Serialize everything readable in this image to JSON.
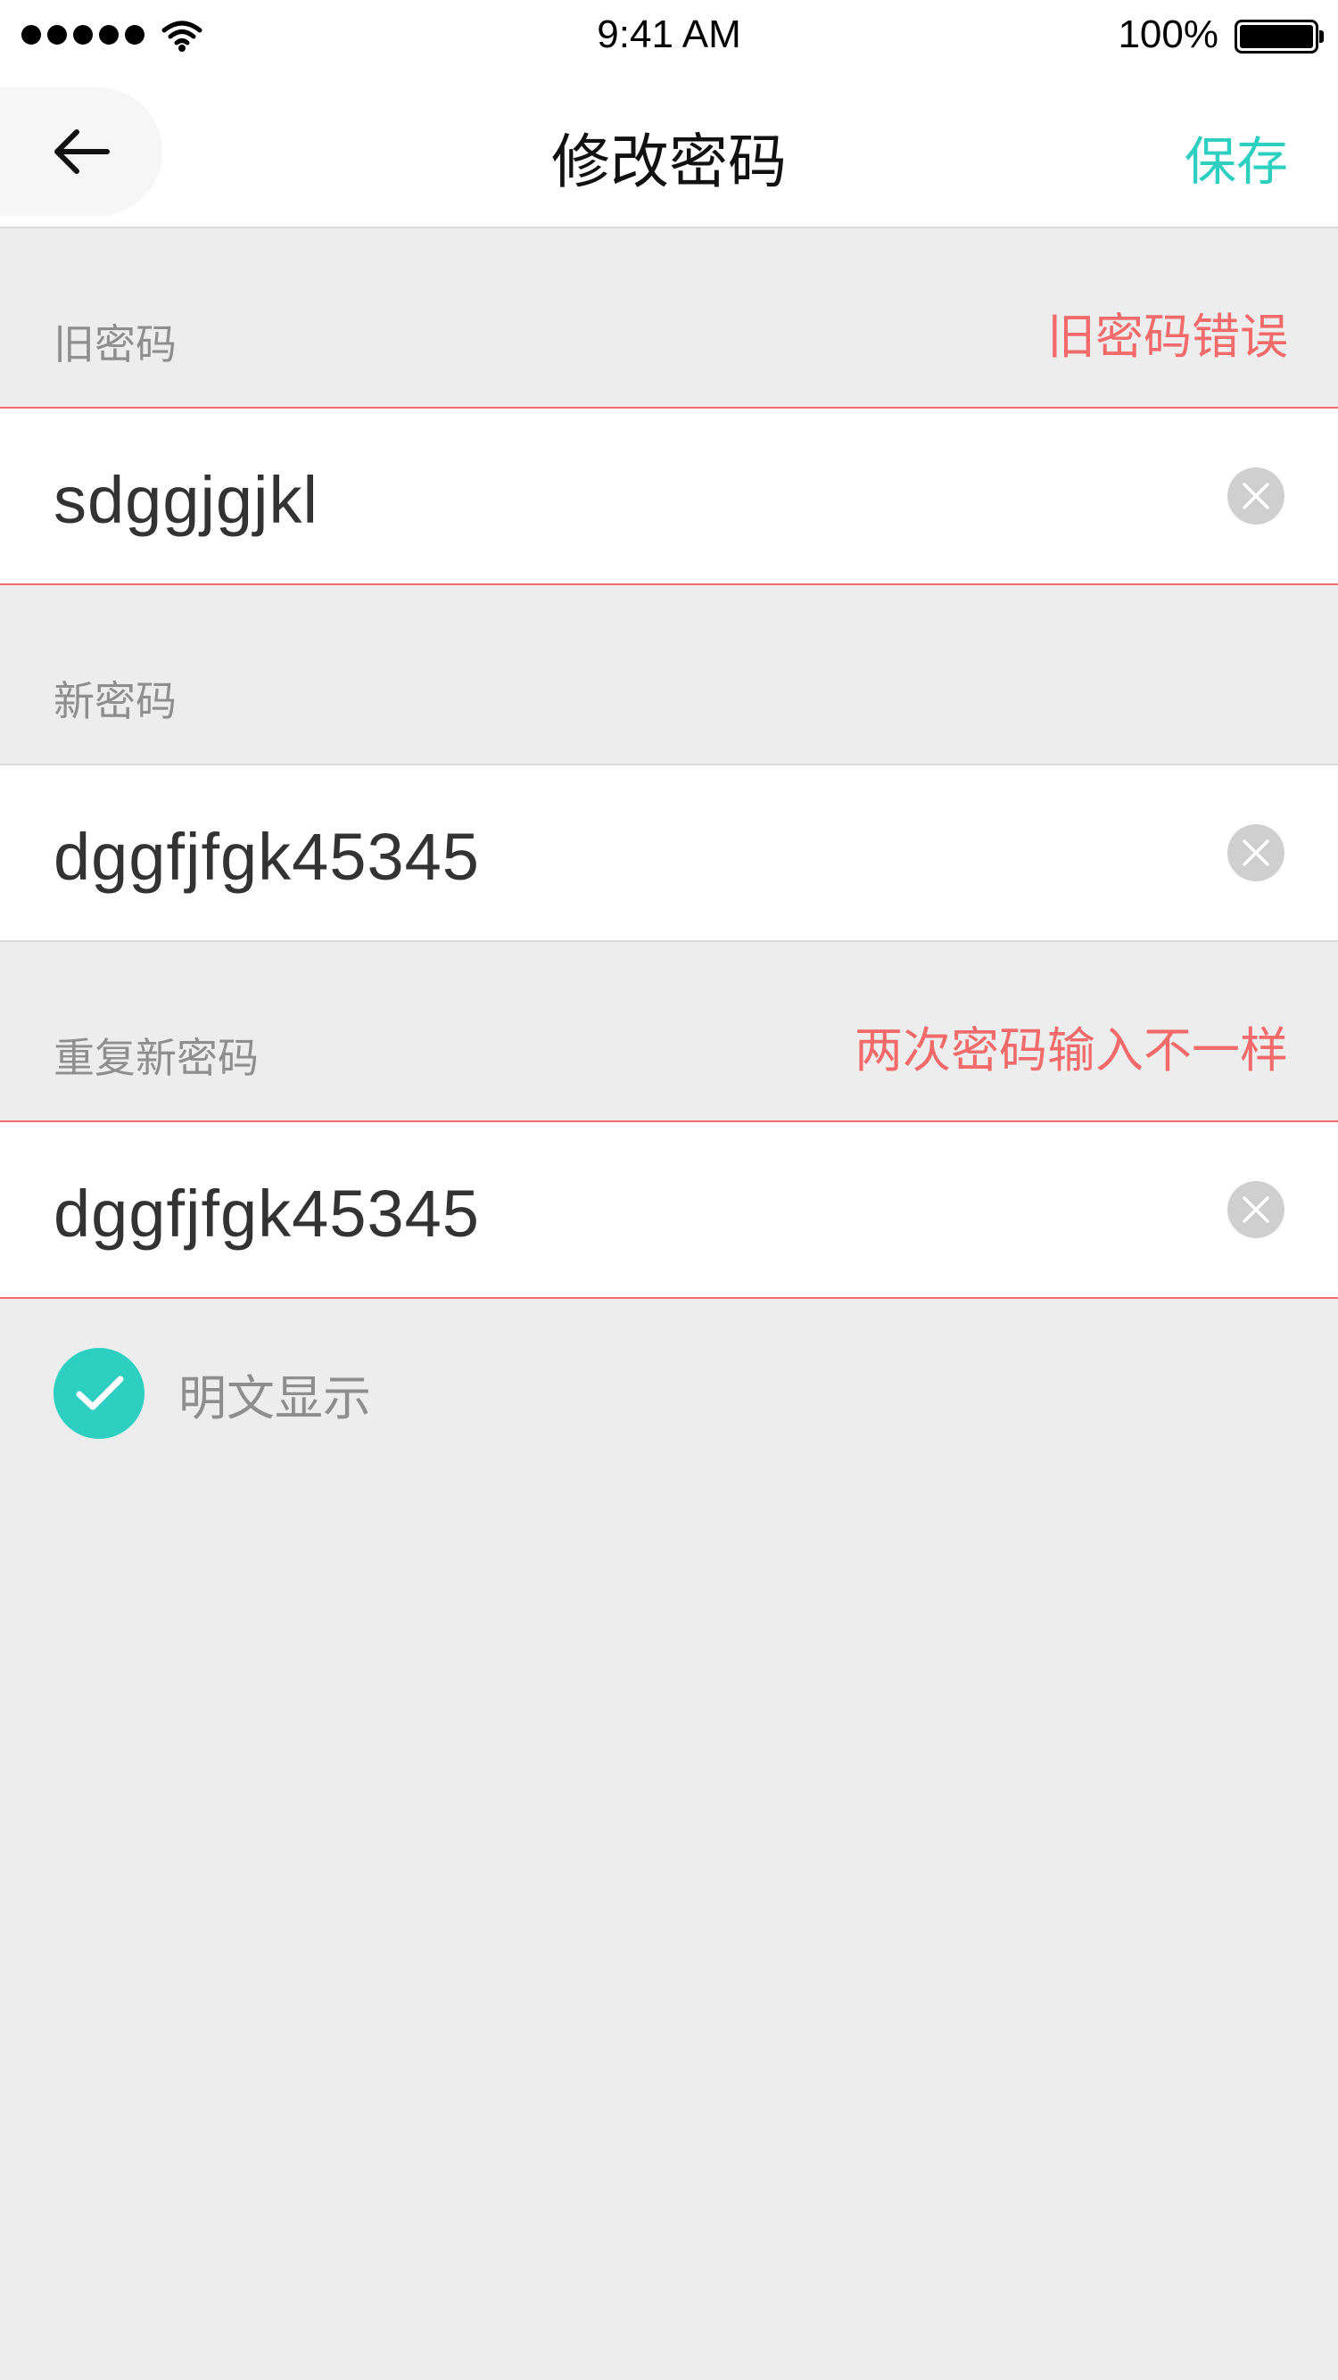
{
  "status_bar": {
    "time": "9:41 AM",
    "battery": "100%",
    "icons": [
      "signal-dots-icon",
      "wifi-icon",
      "battery-icon"
    ]
  },
  "nav": {
    "back_icon": "arrow-left-icon",
    "title": "修改密码",
    "save_label": "保存"
  },
  "fields": {
    "old_password": {
      "label": "旧密码",
      "error": "旧密码错误",
      "value": "sdggjgjkl"
    },
    "new_password": {
      "label": "新密码",
      "value": "dggfjfgk45345"
    },
    "repeat_password": {
      "label": "重复新密码",
      "error": "两次密码输入不一样",
      "value": "dggfjfgk45345"
    }
  },
  "show_plaintext": {
    "label": "明文显示",
    "checked": true
  },
  "colors": {
    "accent": "#2ccfc0",
    "error": "#f26a6a",
    "background": "#ededed"
  }
}
